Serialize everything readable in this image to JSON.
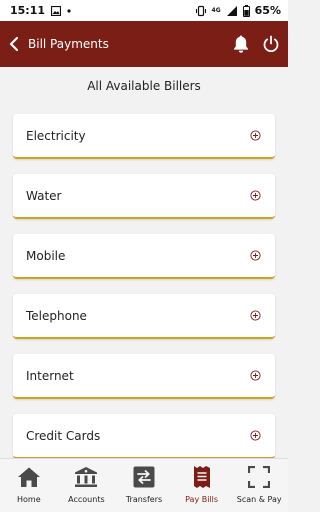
{
  "status_bar": {
    "time": "15:11",
    "network": "4G",
    "battery": "65%"
  },
  "header": {
    "title": "Bill Payments",
    "accent": "#7b1e16"
  },
  "main": {
    "section_title": "All Available Billers",
    "billers": [
      {
        "label": "Electricity"
      },
      {
        "label": "Water"
      },
      {
        "label": "Mobile"
      },
      {
        "label": "Telephone"
      },
      {
        "label": "Internet"
      },
      {
        "label": "Credit Cards"
      }
    ],
    "underline_color": "#d1a21b"
  },
  "bottom_nav": {
    "items": [
      {
        "label": "Home",
        "icon": "home-icon"
      },
      {
        "label": "Accounts",
        "icon": "bank-icon"
      },
      {
        "label": "Transfers",
        "icon": "transfer-icon"
      },
      {
        "label": "Pay Bills",
        "icon": "bill-icon",
        "active": true
      },
      {
        "label": "Scan & Pay",
        "icon": "scan-icon"
      }
    ]
  }
}
